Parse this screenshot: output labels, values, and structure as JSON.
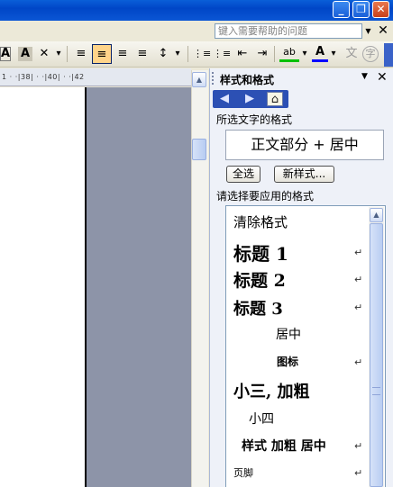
{
  "titlebar": {
    "min_glyph": "_",
    "max_glyph": "❐",
    "close_glyph": "✕"
  },
  "menubar": {
    "help_placeholder": "键入需要帮助的问题",
    "help_dropdown": "▼",
    "close_doc": "✕"
  },
  "toolbar": {
    "font_a": "A",
    "char_shade": "A",
    "char_scale": "✕",
    "dropdown": "▾",
    "align_justify": "≡",
    "align_center": "≡",
    "align_right": "≡",
    "align_distributed": "≡",
    "line_spacing": "↕",
    "numbering": "⋮≡",
    "bullets": "⋮≡",
    "decrease_indent": "⇤",
    "increase_indent": "⇥",
    "highlight": "ab",
    "font_color": "A",
    "phonetic": "文",
    "enclose": "字"
  },
  "ruler": {
    "text": "1 · ·|38| · ·|40| · ·|42"
  },
  "pane": {
    "title": "样式和格式",
    "dropdown": "▼",
    "close": "✕",
    "nav_back": "◀",
    "nav_forward": "▶",
    "nav_home": "⌂",
    "selected_label": "所选文字的格式",
    "current_style": "正文部分 + 居中",
    "select_all": "全选",
    "new_style": "新样式...",
    "apply_label": "请选择要应用的格式",
    "styles": [
      {
        "name": "清除格式",
        "mark": ""
      },
      {
        "name": "标题 1",
        "mark": "↵"
      },
      {
        "name": "标题 2",
        "mark": "↵"
      },
      {
        "name": "标题 3",
        "mark": "↵"
      },
      {
        "name": "居中",
        "mark": ""
      },
      {
        "name": "图标",
        "mark": "↵"
      },
      {
        "name": "小三, 加粗",
        "mark": ""
      },
      {
        "name": "小四",
        "mark": ""
      },
      {
        "name": "样式 加粗 居中",
        "mark": "↵"
      },
      {
        "name": "页脚",
        "mark": "↵"
      }
    ]
  },
  "scroll": {
    "up_glyph": "▲"
  },
  "colors": {
    "title_blue": "#0a5fd8",
    "close_red": "#c7401a",
    "pane_bg": "#eef1f8",
    "workspace": "#8d94a8"
  }
}
